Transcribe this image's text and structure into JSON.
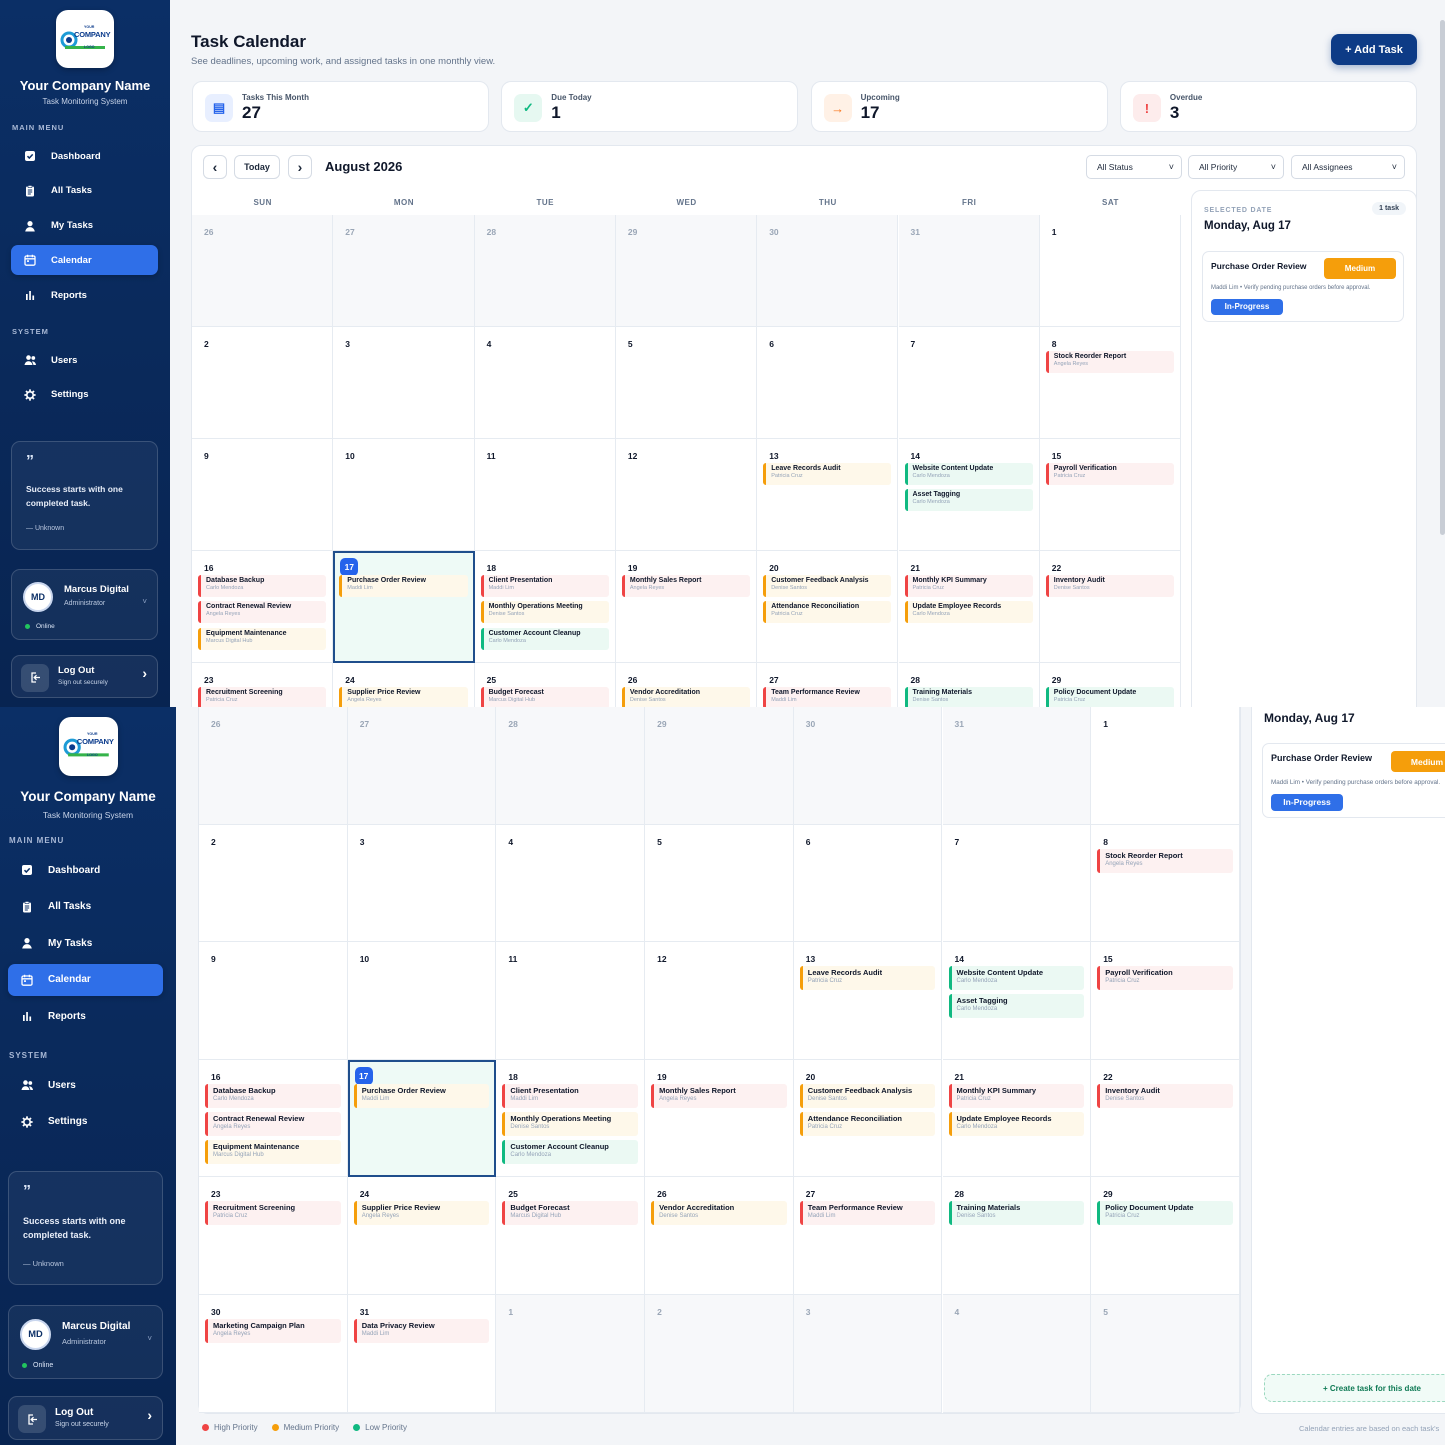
{
  "brand": {
    "logo_word": "COMPANY",
    "logo_small_top": "YOUR",
    "logo_small_bottom": "LOGO",
    "company_name": "Your Company Name",
    "system_name": "Task Monitoring System"
  },
  "sidebar": {
    "main_menu_label": "MAIN MENU",
    "system_label": "SYSTEM",
    "main_items": [
      {
        "label": "Dashboard",
        "icon": "dashboard-icon"
      },
      {
        "label": "All Tasks",
        "icon": "clipboard-icon"
      },
      {
        "label": "My Tasks",
        "icon": "user-icon"
      },
      {
        "label": "Calendar",
        "icon": "calendar-icon",
        "active": true
      },
      {
        "label": "Reports",
        "icon": "bar-chart-icon"
      }
    ],
    "system_items": [
      {
        "label": "Users",
        "icon": "users-icon"
      },
      {
        "label": "Settings",
        "icon": "gear-icon"
      }
    ],
    "quote": {
      "mark": "”",
      "text": "Success starts with one completed task.",
      "author": "— Unknown"
    },
    "user": {
      "initials": "MD",
      "name": "Marcus Digital",
      "role": "Administrator",
      "status": "Online"
    },
    "logout": {
      "label": "Log Out",
      "sub": "Sign out securely"
    }
  },
  "header": {
    "title": "Task Calendar",
    "subtitle": "See deadlines, upcoming work, and assigned tasks in one monthly view.",
    "add_button": "+ Add Task"
  },
  "stats": [
    {
      "label": "Tasks This Month",
      "value": "27",
      "icon": "calendar-icon",
      "color": "#2563eb",
      "bg": "#e8efff",
      "glyph": "▤"
    },
    {
      "label": "Due Today",
      "value": "1",
      "icon": "check-icon",
      "color": "#10b981",
      "bg": "#e6f8f1",
      "glyph": "✓"
    },
    {
      "label": "Upcoming",
      "value": "17",
      "icon": "arrow-right-icon",
      "color": "#f97316",
      "bg": "#fff1e6",
      "glyph": "→"
    },
    {
      "label": "Overdue",
      "value": "3",
      "icon": "alert-icon",
      "color": "#ef4444",
      "bg": "#fdecec",
      "glyph": "!"
    }
  ],
  "toolbar": {
    "prev": "‹",
    "next": "›",
    "today": "Today",
    "month_label": "August 2026",
    "filters": [
      "All Status",
      "All Priority",
      "All Assignees"
    ]
  },
  "weekdays": [
    "SUN",
    "MON",
    "TUE",
    "WED",
    "THU",
    "FRI",
    "SAT"
  ],
  "calendar": {
    "weeks": [
      [
        {
          "d": "26",
          "o": true
        },
        {
          "d": "27",
          "o": true
        },
        {
          "d": "28",
          "o": true
        },
        {
          "d": "29",
          "o": true
        },
        {
          "d": "30",
          "o": true
        },
        {
          "d": "31",
          "o": true
        },
        {
          "d": "1"
        }
      ],
      [
        {
          "d": "2"
        },
        {
          "d": "3"
        },
        {
          "d": "4"
        },
        {
          "d": "5"
        },
        {
          "d": "6"
        },
        {
          "d": "7"
        },
        {
          "d": "8",
          "tasks": [
            {
              "t": "Stock Reorder Report",
              "a": "Angela Reyes",
              "p": "high"
            }
          ]
        }
      ],
      [
        {
          "d": "9"
        },
        {
          "d": "10"
        },
        {
          "d": "11"
        },
        {
          "d": "12"
        },
        {
          "d": "13",
          "tasks": [
            {
              "t": "Leave Records Audit",
              "a": "Patricia Cruz",
              "p": "med"
            }
          ]
        },
        {
          "d": "14",
          "tasks": [
            {
              "t": "Website Content Update",
              "a": "Carlo Mendoza",
              "p": "low"
            },
            {
              "t": "Asset Tagging",
              "a": "Carlo Mendoza",
              "p": "low"
            }
          ]
        },
        {
          "d": "15",
          "tasks": [
            {
              "t": "Payroll Verification",
              "a": "Patricia Cruz",
              "p": "high"
            }
          ]
        }
      ],
      [
        {
          "d": "16",
          "tasks": [
            {
              "t": "Database Backup",
              "a": "Carlo Mendoza",
              "p": "high"
            },
            {
              "t": "Contract Renewal Review",
              "a": "Angela Reyes",
              "p": "high"
            },
            {
              "t": "Equipment Maintenance",
              "a": "Marcus Digital Hub",
              "p": "med"
            }
          ]
        },
        {
          "d": "17",
          "today": true,
          "tasks": [
            {
              "t": "Purchase Order Review",
              "a": "Maddi Lim",
              "p": "med"
            }
          ]
        },
        {
          "d": "18",
          "tasks": [
            {
              "t": "Client Presentation",
              "a": "Maddi Lim",
              "p": "high"
            },
            {
              "t": "Monthly Operations Meeting",
              "a": "Denise Santos",
              "p": "med"
            },
            {
              "t": "Customer Account Cleanup",
              "a": "Carlo Mendoza",
              "p": "low"
            }
          ]
        },
        {
          "d": "19",
          "tasks": [
            {
              "t": "Monthly Sales Report",
              "a": "Angela Reyes",
              "p": "high"
            }
          ]
        },
        {
          "d": "20",
          "tasks": [
            {
              "t": "Customer Feedback Analysis",
              "a": "Denise Santos",
              "p": "med"
            },
            {
              "t": "Attendance Reconciliation",
              "a": "Patricia Cruz",
              "p": "med"
            }
          ]
        },
        {
          "d": "21",
          "tasks": [
            {
              "t": "Monthly KPI Summary",
              "a": "Patricia Cruz",
              "p": "high"
            },
            {
              "t": "Update Employee Records",
              "a": "Carlo Mendoza",
              "p": "med"
            }
          ]
        },
        {
          "d": "22",
          "tasks": [
            {
              "t": "Inventory Audit",
              "a": "Denise Santos",
              "p": "high"
            }
          ]
        }
      ],
      [
        {
          "d": "23",
          "tasks": [
            {
              "t": "Recruitment Screening",
              "a": "Patricia Cruz",
              "p": "high"
            }
          ]
        },
        {
          "d": "24",
          "tasks": [
            {
              "t": "Supplier Price Review",
              "a": "Angela Reyes",
              "p": "med"
            }
          ]
        },
        {
          "d": "25",
          "tasks": [
            {
              "t": "Budget Forecast",
              "a": "Marcus Digital Hub",
              "p": "high"
            }
          ]
        },
        {
          "d": "26",
          "tasks": [
            {
              "t": "Vendor Accreditation",
              "a": "Denise Santos",
              "p": "med"
            }
          ]
        },
        {
          "d": "27",
          "tasks": [
            {
              "t": "Team Performance Review",
              "a": "Maddi Lim",
              "p": "high"
            }
          ]
        },
        {
          "d": "28",
          "tasks": [
            {
              "t": "Training Materials",
              "a": "Denise Santos",
              "p": "low"
            }
          ]
        },
        {
          "d": "29",
          "tasks": [
            {
              "t": "Policy Document Update",
              "a": "Patricia Cruz",
              "p": "low"
            }
          ]
        }
      ],
      [
        {
          "d": "30",
          "tasks": [
            {
              "t": "Marketing Campaign Plan",
              "a": "Angela Reyes",
              "p": "high"
            }
          ]
        },
        {
          "d": "31",
          "tasks": [
            {
              "t": "Data Privacy Review",
              "a": "Maddi Lim",
              "p": "high"
            }
          ]
        },
        {
          "d": "1",
          "o": true
        },
        {
          "d": "2",
          "o": true
        },
        {
          "d": "3",
          "o": true
        },
        {
          "d": "4",
          "o": true
        },
        {
          "d": "5",
          "o": true
        }
      ]
    ]
  },
  "selected": {
    "label": "SELECTED DATE",
    "count": "1 task",
    "date": "Monday, Aug 17",
    "task": {
      "title": "Purchase Order Review",
      "priority": "Medium",
      "desc": "Maddi Lim • Verify pending purchase orders before approval.",
      "status": "In-Progress"
    },
    "create": "+ Create task for this date"
  },
  "legend": [
    {
      "label": "High Priority",
      "color": "#ef4444"
    },
    {
      "label": "Medium Priority",
      "color": "#f59e0b"
    },
    {
      "label": "Low Priority",
      "color": "#10b981"
    }
  ],
  "footer_note": "Calendar entries are based on each task's"
}
